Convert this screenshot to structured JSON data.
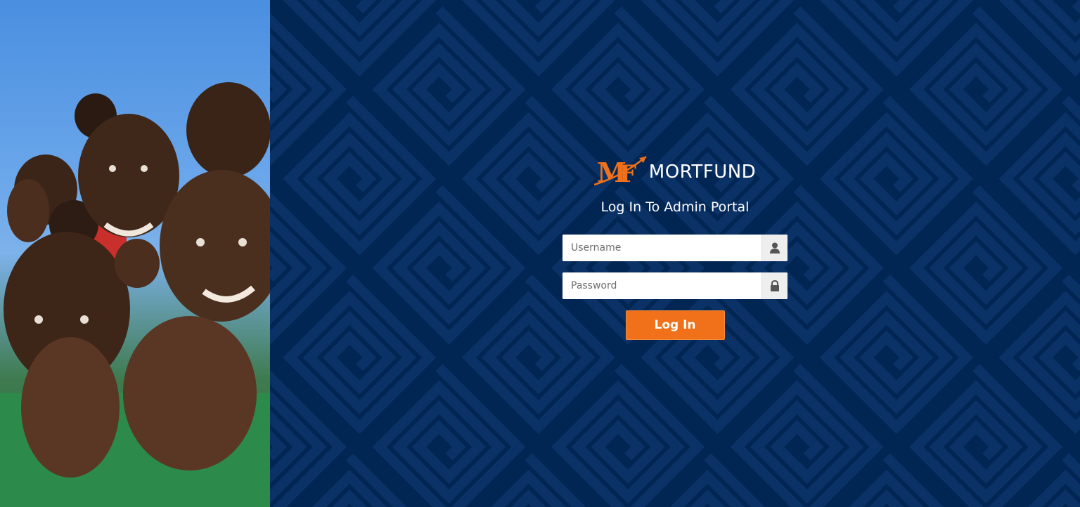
{
  "brand": {
    "name": "MORTFUND",
    "logo_icon": "mf-monogram-logo",
    "accent_color": "#f07119"
  },
  "photo": {
    "description_icon": "children-photo"
  },
  "login": {
    "title": "Log In To Admin Portal",
    "username_placeholder": "Username",
    "password_placeholder": "Password",
    "username_icon": "user-icon",
    "password_icon": "lock-icon",
    "submit_label": "Log In"
  },
  "colors": {
    "panel_background": "#022654",
    "button": "#f07119"
  }
}
